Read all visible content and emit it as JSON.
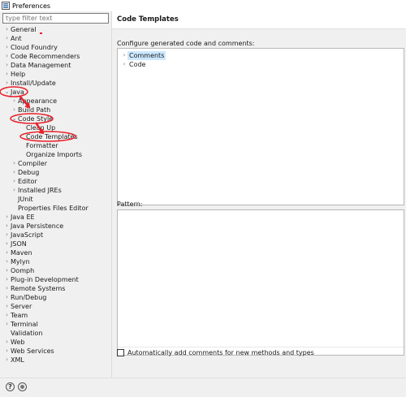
{
  "window": {
    "title": "Preferences"
  },
  "filter": {
    "placeholder": "type filter text"
  },
  "tree": {
    "items": [
      {
        "label": "General",
        "chevron": "›",
        "indent": 0
      },
      {
        "label": "Ant",
        "chevron": "›",
        "indent": 0
      },
      {
        "label": "Cloud Foundry",
        "chevron": "›",
        "indent": 0
      },
      {
        "label": "Code Recommenders",
        "chevron": "›",
        "indent": 0
      },
      {
        "label": "Data Management",
        "chevron": "›",
        "indent": 0
      },
      {
        "label": "Help",
        "chevron": "›",
        "indent": 0
      },
      {
        "label": "Install/Update",
        "chevron": "›",
        "indent": 0
      },
      {
        "label": "Java",
        "chevron": "⌄",
        "indent": 0
      },
      {
        "label": "Appearance",
        "chevron": "›",
        "indent": 1
      },
      {
        "label": "Build Path",
        "chevron": "›",
        "indent": 1
      },
      {
        "label": "Code Style",
        "chevron": "⌄",
        "indent": 1
      },
      {
        "label": "Clean Up",
        "chevron": "",
        "indent": 2
      },
      {
        "label": "Code Templates",
        "chevron": "",
        "indent": 2
      },
      {
        "label": "Formatter",
        "chevron": "",
        "indent": 2
      },
      {
        "label": "Organize Imports",
        "chevron": "",
        "indent": 2
      },
      {
        "label": "Compiler",
        "chevron": "›",
        "indent": 1
      },
      {
        "label": "Debug",
        "chevron": "›",
        "indent": 1
      },
      {
        "label": "Editor",
        "chevron": "›",
        "indent": 1
      },
      {
        "label": "Installed JREs",
        "chevron": "›",
        "indent": 1
      },
      {
        "label": "JUnit",
        "chevron": "",
        "indent": 1
      },
      {
        "label": "Properties Files Editor",
        "chevron": "",
        "indent": 1
      },
      {
        "label": "Java EE",
        "chevron": "›",
        "indent": 0
      },
      {
        "label": "Java Persistence",
        "chevron": "›",
        "indent": 0
      },
      {
        "label": "JavaScript",
        "chevron": "›",
        "indent": 0
      },
      {
        "label": "JSON",
        "chevron": "›",
        "indent": 0
      },
      {
        "label": "Maven",
        "chevron": "›",
        "indent": 0
      },
      {
        "label": "Mylyn",
        "chevron": "›",
        "indent": 0
      },
      {
        "label": "Oomph",
        "chevron": "›",
        "indent": 0
      },
      {
        "label": "Plug-in Development",
        "chevron": "›",
        "indent": 0
      },
      {
        "label": "Remote Systems",
        "chevron": "›",
        "indent": 0
      },
      {
        "label": "Run/Debug",
        "chevron": "›",
        "indent": 0
      },
      {
        "label": "Server",
        "chevron": "›",
        "indent": 0
      },
      {
        "label": "Team",
        "chevron": "›",
        "indent": 0
      },
      {
        "label": "Terminal",
        "chevron": "›",
        "indent": 0
      },
      {
        "label": "Validation",
        "chevron": "",
        "indent": 0
      },
      {
        "label": "Web",
        "chevron": "›",
        "indent": 0
      },
      {
        "label": "Web Services",
        "chevron": "›",
        "indent": 0
      },
      {
        "label": "XML",
        "chevron": "›",
        "indent": 0
      }
    ]
  },
  "page": {
    "title": "Code Templates",
    "description": "Configure generated code and comments:",
    "templates": [
      {
        "label": "Comments",
        "chevron": "›",
        "selected": true
      },
      {
        "label": "Code",
        "chevron": "›",
        "selected": false
      }
    ],
    "pattern_label": "Pattern:",
    "scroll_left": "‹",
    "auto_comments_label": "Automatically add comments for new methods and types"
  },
  "bottom": {
    "help_icon": "?"
  },
  "colors": {
    "annotation": "#e8202a",
    "selection": "#cce8ff"
  }
}
